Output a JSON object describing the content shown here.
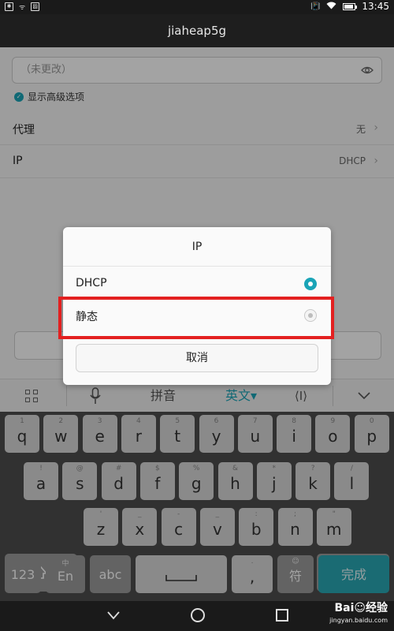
{
  "status_bar": {
    "time": "13:45"
  },
  "header": {
    "title": "jiaheap5g"
  },
  "settings": {
    "password_placeholder": "（未更改）",
    "show_advanced": "显示高级选项",
    "proxy": {
      "label": "代理",
      "value": "无"
    },
    "ip": {
      "label": "IP",
      "value": "DHCP"
    }
  },
  "dialog": {
    "title": "IP",
    "options": [
      {
        "label": "DHCP",
        "selected": true
      },
      {
        "label": "静态",
        "selected": false
      }
    ],
    "cancel": "取消"
  },
  "keyboard": {
    "toolbar": {
      "pinyin": "拼音",
      "english": "英文▾",
      "cursor": "⟨I⟩"
    },
    "row1": [
      {
        "sub": "1",
        "main": "q"
      },
      {
        "sub": "2",
        "main": "w"
      },
      {
        "sub": "3",
        "main": "e"
      },
      {
        "sub": "4",
        "main": "r"
      },
      {
        "sub": "5",
        "main": "t"
      },
      {
        "sub": "6",
        "main": "y"
      },
      {
        "sub": "7",
        "main": "u"
      },
      {
        "sub": "8",
        "main": "i"
      },
      {
        "sub": "9",
        "main": "o"
      },
      {
        "sub": "0",
        "main": "p"
      }
    ],
    "row2": [
      {
        "sub": "!",
        "main": "a"
      },
      {
        "sub": "@",
        "main": "s"
      },
      {
        "sub": "#",
        "main": "d"
      },
      {
        "sub": "$",
        "main": "f"
      },
      {
        "sub": "%",
        "main": "g"
      },
      {
        "sub": "&",
        "main": "h"
      },
      {
        "sub": "*",
        "main": "j"
      },
      {
        "sub": "?",
        "main": "k"
      },
      {
        "sub": "/",
        "main": "l"
      }
    ],
    "row3": [
      {
        "sub": "'",
        "main": "z"
      },
      {
        "sub": "_",
        "main": "x"
      },
      {
        "sub": "-",
        "main": "c"
      },
      {
        "sub": "_",
        "main": "v"
      },
      {
        "sub": ":",
        "main": "b"
      },
      {
        "sub": ";",
        "main": "n"
      },
      {
        "sub": "\"",
        "main": "m"
      }
    ],
    "row4": {
      "num": "123",
      "en_sub": "中",
      "en": "En",
      "abc": "abc",
      "punct_sub": ".",
      "punct": ",",
      "sym_sub": "☺",
      "sym": "符",
      "done": "完成"
    }
  },
  "watermark": {
    "brand": "Bai☺经验",
    "url": "jingyan.baidu.com"
  },
  "colors": {
    "accent": "#1aa4b7",
    "highlight": "#e32020",
    "done_key": "#29a8b4"
  }
}
